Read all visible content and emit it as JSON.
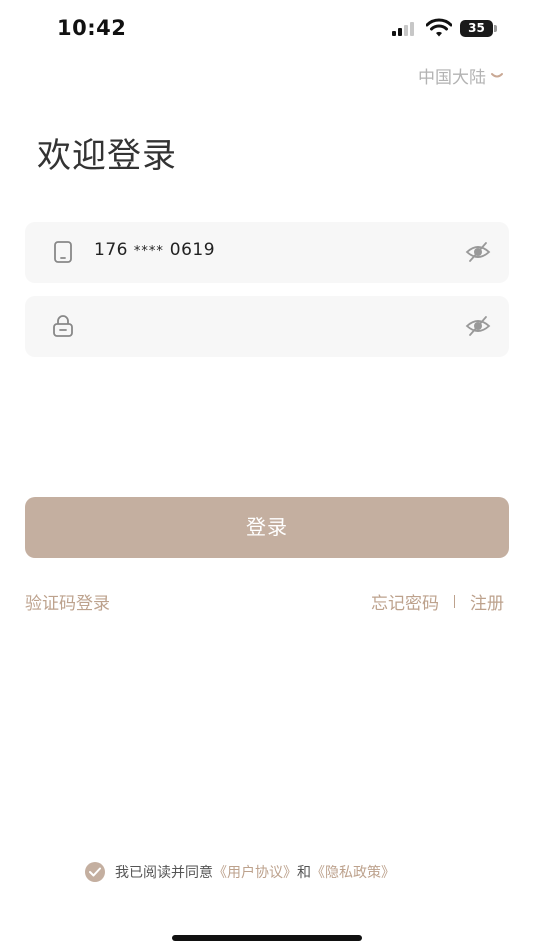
{
  "status_bar": {
    "time": "10:42",
    "battery_level": "35",
    "signal_bars_active": 2,
    "signal_bars_total": 4,
    "battery_percent": 35
  },
  "region": {
    "label": "中国大陆",
    "icon": "chevron-down-icon",
    "color": "#b3b3b3"
  },
  "title": "欢迎登录",
  "phone_field": {
    "icon": "phone-icon",
    "value_prefix": "176",
    "value_mask": "****",
    "value_suffix": "0619",
    "toggle_icon": "eye-off-icon"
  },
  "password_field": {
    "icon": "lock-icon",
    "value": "",
    "placeholder": "",
    "toggle_icon": "eye-off-icon"
  },
  "login_button": {
    "label": "登录",
    "color": "#c4afa0"
  },
  "links": {
    "sms_login": "验证码登录",
    "forgot_password": "忘记密码",
    "register": "注册",
    "color": "#bda28d"
  },
  "agreement": {
    "checked": true,
    "text_before": "我已阅读并同意",
    "user_agreement": "《用户协议》",
    "conjunction": "和",
    "privacy_policy": "《隐私政策》"
  }
}
